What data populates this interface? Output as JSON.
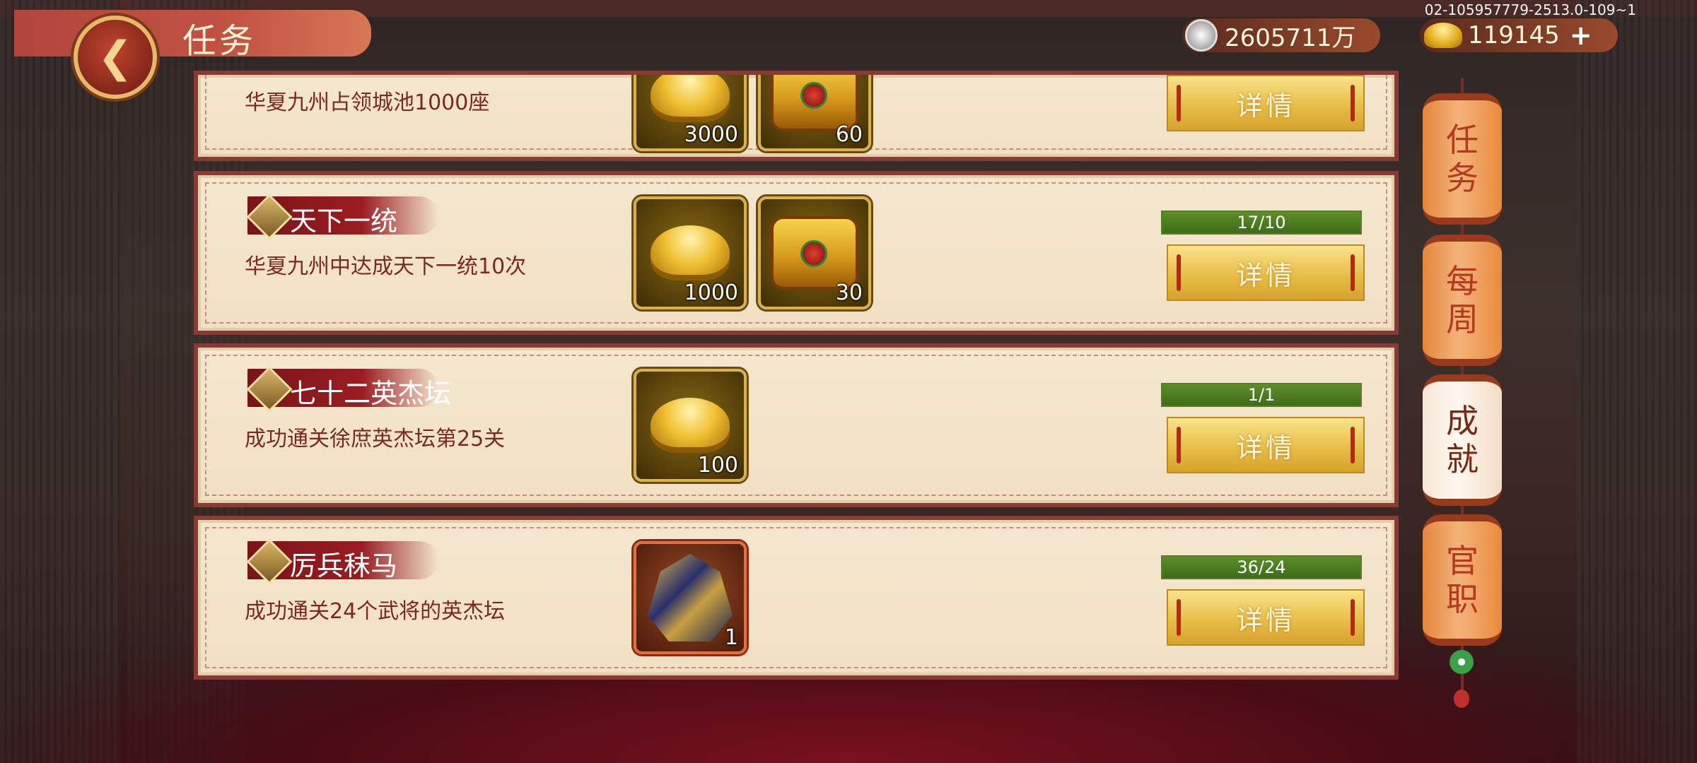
{
  "header": {
    "title": "任务",
    "back_icon": "back-arrow-icon"
  },
  "currency": {
    "silver": "2605711万",
    "gold": "119145",
    "gold_plus": "+"
  },
  "debug_id": "02-105957779-2513.0-109~1",
  "tasks": [
    {
      "name": "",
      "desc": "华夏九州占领城池1000座",
      "rewards": [
        {
          "type": "gold-ingot",
          "count": "3000"
        },
        {
          "type": "treasure-chest",
          "count": "60"
        }
      ],
      "button": "详情"
    },
    {
      "name": "天下一统",
      "desc": "华夏九州中达成天下一统10次",
      "rewards": [
        {
          "type": "gold-ingot",
          "count": "1000"
        },
        {
          "type": "treasure-chest",
          "count": "30"
        }
      ],
      "progress": "17/10",
      "progress_ratio": 1.0,
      "button": "详情"
    },
    {
      "name": "七十二英杰坛",
      "desc": "成功通关徐庶英杰坛第25关",
      "rewards": [
        {
          "type": "gold-ingot",
          "count": "100"
        }
      ],
      "progress": "1/1",
      "progress_ratio": 1.0,
      "button": "详情"
    },
    {
      "name": "厉兵秣马",
      "desc": "成功通关24个武将的英杰坛",
      "rewards": [
        {
          "type": "armor-item",
          "count": "1"
        }
      ],
      "progress": "36/24",
      "progress_ratio": 1.0,
      "button": "详情"
    }
  ],
  "side_tabs": [
    {
      "label": "任务",
      "chars": [
        "任",
        "务"
      ],
      "active": false
    },
    {
      "label": "每周",
      "chars": [
        "每",
        "周"
      ],
      "active": false
    },
    {
      "label": "成就",
      "chars": [
        "成",
        "就"
      ],
      "active": true
    },
    {
      "label": "官职",
      "chars": [
        "官",
        "职"
      ],
      "active": false
    }
  ]
}
